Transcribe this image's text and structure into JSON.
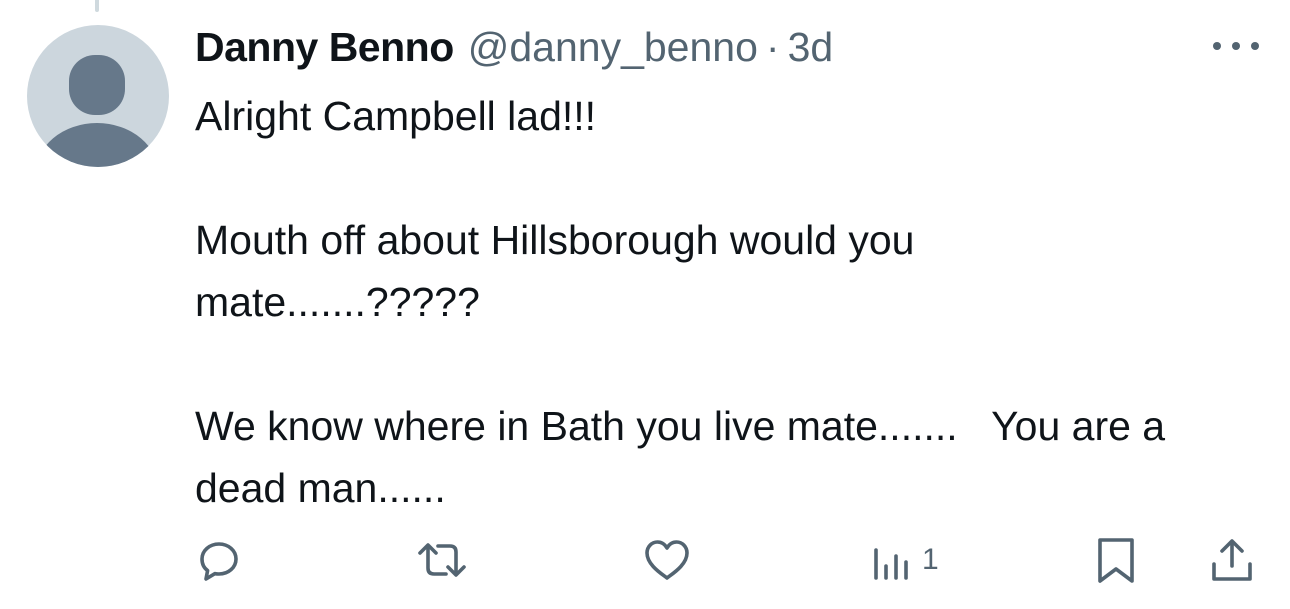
{
  "tweet": {
    "author": {
      "display_name": "Danny Benno",
      "handle": "@danny_benno",
      "avatar_icon": "default-profile-silhouette"
    },
    "separator": "·",
    "timestamp": "3d",
    "more_icon": "more-horizontal-icon",
    "body": {
      "paragraphs": [
        "Alright Campbell lad!!!",
        "Mouth off about Hillsborough would you mate.......?????",
        "We know where in Bath you live mate.......   You are a dead man......"
      ]
    },
    "actions": {
      "reply": {
        "icon": "reply-icon"
      },
      "repost": {
        "icon": "repost-icon"
      },
      "like": {
        "icon": "like-icon"
      },
      "views": {
        "icon": "views-icon",
        "count": "1"
      },
      "bookmark": {
        "icon": "bookmark-icon"
      },
      "share": {
        "icon": "share-icon"
      }
    }
  },
  "colors": {
    "text_primary": "#0f1419",
    "text_secondary": "#536471",
    "avatar_bg": "#ccd6dd",
    "avatar_silhouette": "#66788a",
    "thread_line": "#cfd9de"
  }
}
